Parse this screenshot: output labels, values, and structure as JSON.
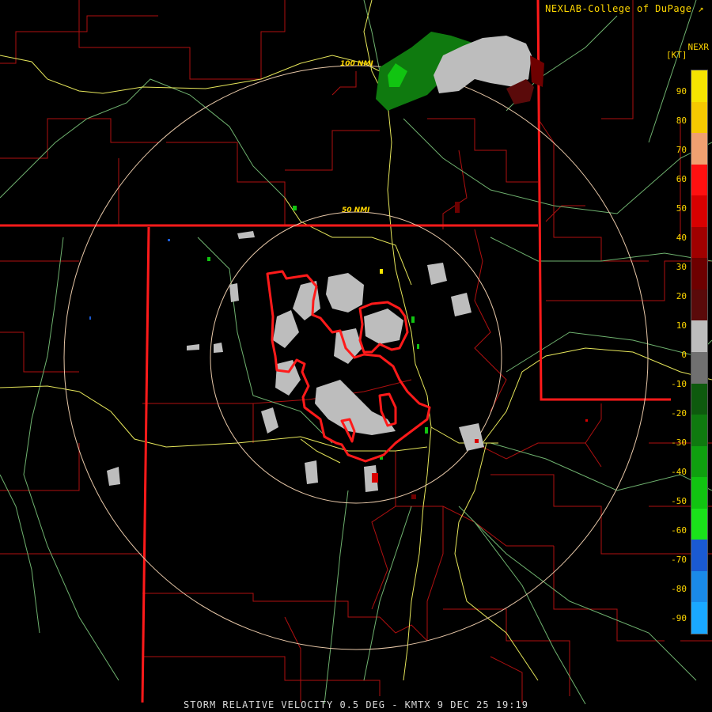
{
  "credit": "NEXLAB-College of DuPage",
  "product_code": "NEXR",
  "units": "[KT]",
  "range_rings": [
    {
      "label": "100 NMI"
    },
    {
      "label": "50 NMI"
    }
  ],
  "legend_ticks": [
    "90",
    "80",
    "70",
    "60",
    "50",
    "40",
    "30",
    "20",
    "10",
    "0",
    "-10",
    "-20",
    "-30",
    "-40",
    "-50",
    "-60",
    "-70",
    "-80",
    "-90"
  ],
  "product_title": "STORM RELATIVE VELOCITY 0.5 DEG - KMTX 9 DEC 25 19:19",
  "colors": {
    "state_border": "#ff1a1a",
    "county_border": "#b01010",
    "highway": "#e6e65a",
    "road": "#6fb26f",
    "range_ring": "#e8c8a8",
    "warning_polygon": "#ff1a1a",
    "label": "#ffd700"
  },
  "colorbar": [
    {
      "color": "#f5e400"
    },
    {
      "color": "#f5c900"
    },
    {
      "color": "#f0a070"
    },
    {
      "color": "#ff1010"
    },
    {
      "color": "#d80000"
    },
    {
      "color": "#a00000"
    },
    {
      "color": "#6e0000"
    },
    {
      "color": "#5a0a0a"
    },
    {
      "color": "#bdbdbd"
    },
    {
      "color": "#707070"
    },
    {
      "color": "#0e5a0e"
    },
    {
      "color": "#0f7a0f"
    },
    {
      "color": "#0fa00f"
    },
    {
      "color": "#11c411"
    },
    {
      "color": "#1ae21a"
    },
    {
      "color": "#1a5ad2"
    },
    {
      "color": "#1a8ae8"
    },
    {
      "color": "#1aa8ff"
    }
  ]
}
